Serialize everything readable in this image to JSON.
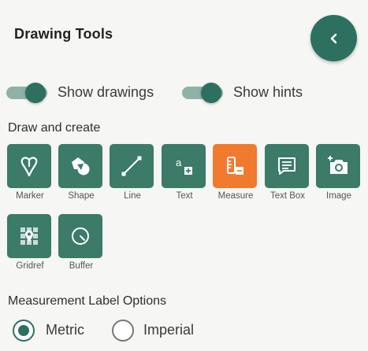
{
  "panel": {
    "title": "Drawing Tools",
    "collapse_icon": "chevron-left-icon"
  },
  "toggles": [
    {
      "label": "Show drawings",
      "on": true
    },
    {
      "label": "Show hints",
      "on": true
    }
  ],
  "draw_section": {
    "label": "Draw and create",
    "tools": [
      {
        "label": "Marker",
        "icon": "marker-icon",
        "active": false
      },
      {
        "label": "Shape",
        "icon": "shape-icon",
        "active": false
      },
      {
        "label": "Line",
        "icon": "line-icon",
        "active": false
      },
      {
        "label": "Text",
        "icon": "text-icon",
        "active": false
      },
      {
        "label": "Measure",
        "icon": "measure-icon",
        "active": true
      },
      {
        "label": "Text Box",
        "icon": "text-box-icon",
        "active": false
      },
      {
        "label": "Image",
        "icon": "add-image-icon",
        "active": false
      },
      {
        "label": "Gridref",
        "icon": "gridref-icon",
        "active": false
      },
      {
        "label": "Buffer",
        "icon": "buffer-icon",
        "active": false
      }
    ]
  },
  "measurement": {
    "label": "Measurement Label Options",
    "options": [
      {
        "label": "Metric",
        "checked": true
      },
      {
        "label": "Imperial",
        "checked": false
      }
    ]
  },
  "colors": {
    "primary": "#2e7060",
    "tile": "#3b7b68",
    "active_tile": "#f07a2e",
    "background": "#f6f6f4"
  }
}
